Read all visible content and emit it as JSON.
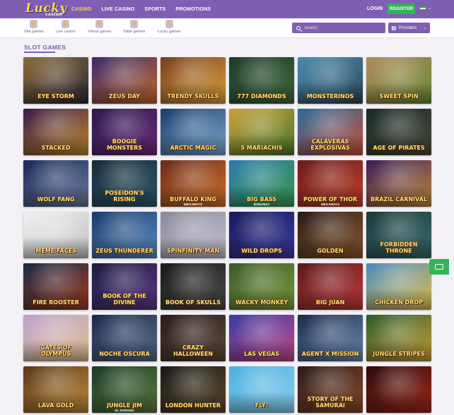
{
  "header": {
    "logo": "Lucky",
    "logo_sub": "casino",
    "nav": [
      {
        "label": "CASINO",
        "active": true
      },
      {
        "label": "LIVE CASINO",
        "active": false
      },
      {
        "label": "SPORTS",
        "active": false
      },
      {
        "label": "PROMOTIONS",
        "active": false
      }
    ],
    "login": "LOGIN",
    "register": "REGISTER",
    "language_icon": "flag-icon"
  },
  "subnav": {
    "categories": [
      {
        "label": "Slot games",
        "icon": "slot-icon"
      },
      {
        "label": "Live casino",
        "icon": "live-casino-icon"
      },
      {
        "label": "Virtual games",
        "icon": "virtual-games-icon"
      },
      {
        "label": "Table games",
        "icon": "table-games-icon"
      },
      {
        "label": "Lucky games",
        "icon": "lucky-games-icon"
      }
    ],
    "search_placeholder": "Search",
    "providers_label": "Providers"
  },
  "section": {
    "title": "SLOT GAMES"
  },
  "games": [
    {
      "name": "EYE STORM",
      "sub": ""
    },
    {
      "name": "ZEUS DAY",
      "sub": ""
    },
    {
      "name": "TRENDY SKULLS",
      "sub": ""
    },
    {
      "name": "777 Diamonds",
      "sub": ""
    },
    {
      "name": "MONSTERINOS",
      "sub": ""
    },
    {
      "name": "Sweet Spin",
      "sub": ""
    },
    {
      "name": "Stacked",
      "sub": ""
    },
    {
      "name": "Boogie Monsters",
      "sub": ""
    },
    {
      "name": "ARCTIC MAGIC",
      "sub": ""
    },
    {
      "name": "5 MARIACHIS",
      "sub": ""
    },
    {
      "name": "CALAVERAS EXPLOSIVAS",
      "sub": ""
    },
    {
      "name": "AGE OF PIRATES",
      "sub": ""
    },
    {
      "name": "WOLF FANG",
      "sub": ""
    },
    {
      "name": "POSEIDON'S RISING",
      "sub": ""
    },
    {
      "name": "BUFFALO KING",
      "sub": "MEGAWAYS"
    },
    {
      "name": "BIG BASS",
      "sub": "BONANZA"
    },
    {
      "name": "POWER OF THOR",
      "sub": "MEGAWAYS"
    },
    {
      "name": "BRAZIL CARNIVAL",
      "sub": ""
    },
    {
      "name": "MEME FACES",
      "sub": ""
    },
    {
      "name": "ZEUS THUNDERER",
      "sub": ""
    },
    {
      "name": "SPINFINITY MAN",
      "sub": ""
    },
    {
      "name": "WILD DROPS",
      "sub": ""
    },
    {
      "name": "GOLDEN",
      "sub": ""
    },
    {
      "name": "FORBIDDEN THRONE",
      "sub": ""
    },
    {
      "name": "FIRE ROOSTER",
      "sub": ""
    },
    {
      "name": "BOOK OF THE DIVINE",
      "sub": ""
    },
    {
      "name": "BOOK OF SKULLS",
      "sub": ""
    },
    {
      "name": "WACKY MONKEY",
      "sub": ""
    },
    {
      "name": "BIG JUAN",
      "sub": ""
    },
    {
      "name": "CHICKEN DROP",
      "sub": ""
    },
    {
      "name": "GATES OF OLYMPUS",
      "sub": ""
    },
    {
      "name": "Noche Oscura",
      "sub": ""
    },
    {
      "name": "CRAZY HALLOWEEN",
      "sub": ""
    },
    {
      "name": "LAS VEGAS",
      "sub": ""
    },
    {
      "name": "AGENT X MISSION",
      "sub": ""
    },
    {
      "name": "Jungle Stripes",
      "sub": ""
    },
    {
      "name": "LAVA GOLD",
      "sub": ""
    },
    {
      "name": "JUNGLE JIM",
      "sub": "EL DORADO"
    },
    {
      "name": "London Hunter",
      "sub": ""
    },
    {
      "name": "FLY!",
      "sub": ""
    },
    {
      "name": "STORY OF THE SAMURAI",
      "sub": ""
    },
    {
      "name": "",
      "sub": ""
    }
  ],
  "tile_colors": [
    [
      "#8a6a3a",
      "#2d2a35"
    ],
    [
      "#3b2a6e",
      "#c46a2a"
    ],
    [
      "#7a3c1c",
      "#d9a23a"
    ],
    [
      "#1f3a2a",
      "#3a6a3a"
    ],
    [
      "#4a8ab0",
      "#2a4a5a"
    ],
    [
      "#b08a5a",
      "#6a8a3a"
    ],
    [
      "#3a1a4a",
      "#c08a2a"
    ],
    [
      "#2a1a4a",
      "#6a2a7a"
    ],
    [
      "#1a3a6a",
      "#7aa8d0"
    ],
    [
      "#c8a03a",
      "#4a7a2a"
    ],
    [
      "#2a6a9a",
      "#c8503a"
    ],
    [
      "#1a2a2a",
      "#4a4a3a"
    ],
    [
      "#1a2a5a",
      "#6a7a9a"
    ],
    [
      "#1a2a3a",
      "#2a5a6a"
    ],
    [
      "#6a2a1a",
      "#d0702a"
    ],
    [
      "#2a7ab0",
      "#3a9a4a"
    ],
    [
      "#6a1a1a",
      "#c0402a"
    ],
    [
      "#3a1a5a",
      "#c08a3a"
    ],
    [
      "#f0f0f0",
      "#c0c0c0"
    ],
    [
      "#1a3a6a",
      "#5a8ac0"
    ],
    [
      "#8a8a9a",
      "#c0c0d0"
    ],
    [
      "#1a1a5a",
      "#3a3aa0"
    ],
    [
      "#2a1a1a",
      "#8a5a2a"
    ],
    [
      "#1a3a3a",
      "#3a6a6a"
    ],
    [
      "#1a2a4a",
      "#a03a1a"
    ],
    [
      "#1a1a3a",
      "#5a3a8a"
    ],
    [
      "#1a1a1a",
      "#4a4a4a"
    ],
    [
      "#3a5a2a",
      "#7a9a3a"
    ],
    [
      "#5a1a1a",
      "#c03a3a"
    ],
    [
      "#4a8ac0",
      "#e0c04a"
    ],
    [
      "#c0a0d0",
      "#e0c08a"
    ],
    [
      "#1a2a4a",
      "#5a6a8a"
    ],
    [
      "#2a1a1a",
      "#5a4a3a"
    ],
    [
      "#3a3aa0",
      "#c04a8a"
    ],
    [
      "#1a2a4a",
      "#6a8ab0"
    ],
    [
      "#2a5a2a",
      "#c8a03a"
    ],
    [
      "#5a3a1a",
      "#c08a3a"
    ],
    [
      "#1a3a2a",
      "#5a7a3a"
    ],
    [
      "#1a1a1a",
      "#5a4a2a"
    ],
    [
      "#4ab0e0",
      "#8ad0f0"
    ],
    [
      "#2a1a1a",
      "#8a4a2a"
    ],
    [
      "#2a0a0a",
      "#a02a1a"
    ]
  ]
}
